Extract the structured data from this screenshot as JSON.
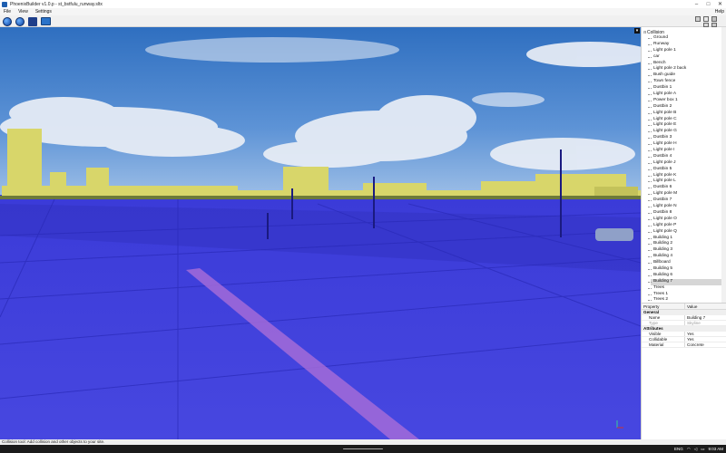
{
  "window": {
    "title": "PhoenixBuilder v1.0.p - st_bstfulu_runway.sltx",
    "min_glyph": "–",
    "max_glyph": "□",
    "close_glyph": "✕"
  },
  "menu": {
    "items": [
      "File",
      "View",
      "Settings"
    ],
    "help": "Help"
  },
  "toolbar": {
    "buttons": [
      "globe-icon",
      "globe-alt-icon",
      "save-icon",
      "monitor-icon"
    ],
    "right_buttons": [
      "wireframe-icon",
      "grid-icon",
      "select-icon",
      "move-icon",
      "rotate-icon"
    ]
  },
  "viewport": {
    "corner_glyph": "▾",
    "axis_label": "y"
  },
  "tree": {
    "root": "Collision",
    "toggle": "⊟",
    "items": [
      "Ground",
      "Runway",
      "Light pole 1",
      "car",
      "Bench",
      "Light pole 2 back",
      "Bush guide",
      "Town fence",
      "Dustbin 1",
      "Light pole A",
      "Power box 1",
      "Dustbin 2",
      "Light pole B",
      "Light pole C",
      "Light pole E",
      "Light pole G",
      "Dustbin 3",
      "Light pole H",
      "Light pole I",
      "Dustbin 4",
      "Light pole J",
      "Dustbin 5",
      "Light pole K",
      "Light pole L",
      "Dustbin 6",
      "Light pole M",
      "Dustbin 7",
      "Light pole N",
      "Dustbin 8",
      "Light pole O",
      "Light pole P",
      "Light pole Q",
      "Building 1",
      "Building 2",
      "Building 3",
      "Building 4",
      "Billboard",
      "Building 5",
      "Building 6",
      "Building 7",
      "Trees",
      "Trees 1",
      "Trees 2"
    ],
    "selected": "Building 7"
  },
  "properties": {
    "col_property": "Property",
    "col_value": "Value",
    "sections": [
      {
        "title": "General",
        "rows": [
          {
            "name": "Name",
            "value": "Building 7",
            "dim": false
          },
          {
            "name": "Type",
            "value": "Skyline",
            "dim": true
          }
        ]
      },
      {
        "title": "Attributes",
        "rows": [
          {
            "name": "Visible",
            "value": "Yes",
            "dim": false
          },
          {
            "name": "Collidable",
            "value": "Yes",
            "dim": false
          },
          {
            "name": "Material",
            "value": "Concrete",
            "dim": false
          }
        ]
      }
    ]
  },
  "status": {
    "text": "Collision tool: Add collision and other objects to your site."
  },
  "taskbar": {
    "lang": "ENG",
    "time": "9:03 AM"
  }
}
